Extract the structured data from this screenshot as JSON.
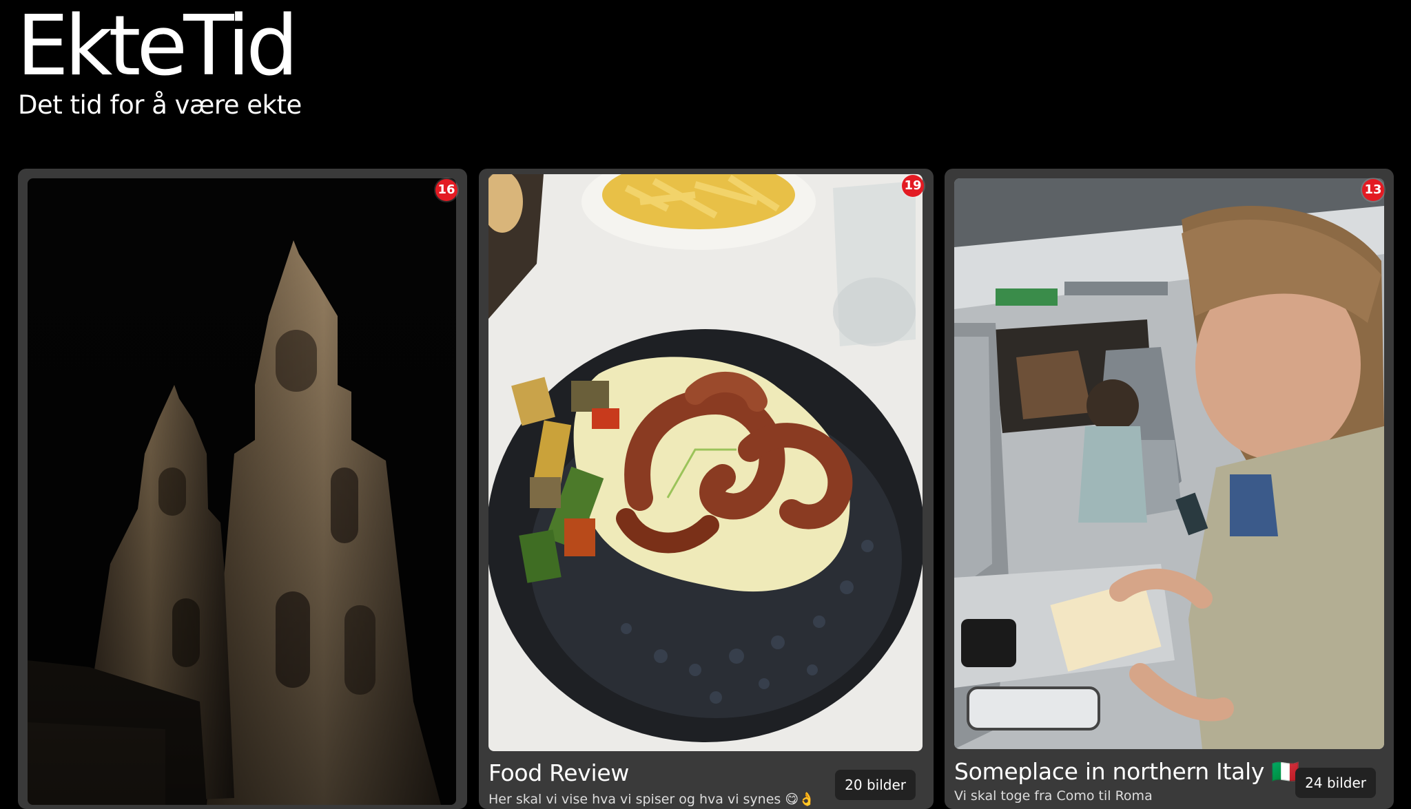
{
  "app": {
    "title": "EkteTid",
    "tagline": "Det tid for å være ekte"
  },
  "cards": [
    {
      "title": "",
      "description": "",
      "count": "16",
      "photos_label": "",
      "photo": "church-towers-night"
    },
    {
      "title": "Food Review",
      "description": "Her skal vi vise hva vi spiser og hva vi synes 😋👌",
      "count": "19",
      "photos_label": "20 bilder",
      "photo": "octopus-dish"
    },
    {
      "title": "Someplace in northern Italy 🇮🇹",
      "description": "Vi skal toge fra Como til Roma",
      "count": "13",
      "photos_label": "24 bilder",
      "photo": "train-interior"
    }
  ],
  "colors": {
    "background": "#000000",
    "card": "#3a3a3a",
    "badge": "#e31b23",
    "pill": "#222222"
  }
}
